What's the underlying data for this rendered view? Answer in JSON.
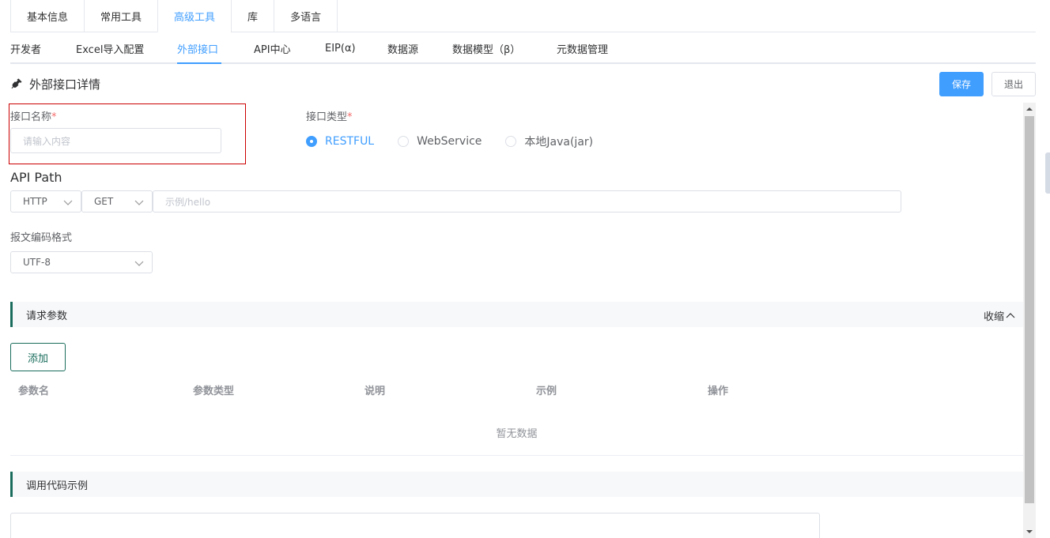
{
  "top_tabs": [
    {
      "label": "基本信息"
    },
    {
      "label": "常用工具"
    },
    {
      "label": "高级工具",
      "active": true
    },
    {
      "label": "库"
    },
    {
      "label": "多语言"
    }
  ],
  "sub_tabs": [
    {
      "label": "开发者"
    },
    {
      "label": "Excel导入配置"
    },
    {
      "label": "外部接口",
      "active": true
    },
    {
      "label": "API中心"
    },
    {
      "label": "EIP(α)"
    },
    {
      "label": "数据源"
    },
    {
      "label": "数据模型（β）"
    },
    {
      "label": "元数据管理"
    }
  ],
  "header": {
    "title": "外部接口详情",
    "icon": "plug-icon",
    "save_label": "保存",
    "exit_label": "退出"
  },
  "form": {
    "name_label": "接口名称",
    "required_mark": "*",
    "name_placeholder": "请输入内容",
    "type_label": "接口类型",
    "type_options": [
      {
        "label": "RESTFUL",
        "checked": true
      },
      {
        "label": "WebService",
        "checked": false
      },
      {
        "label": "本地Java(jar)",
        "checked": false
      }
    ],
    "api_path_label": "API Path",
    "protocol_value": "HTTP",
    "method_value": "GET",
    "path_placeholder": "示例/hello",
    "encoding_label": "报文编码格式",
    "encoding_value": "UTF-8"
  },
  "request_params": {
    "title": "请求参数",
    "collapse_label": "收缩",
    "add_label": "添加",
    "columns": [
      "参数名",
      "参数类型",
      "说明",
      "示例",
      "操作"
    ],
    "empty_text": "暂无数据"
  },
  "code_example": {
    "title": "调用代码示例"
  },
  "colors": {
    "primary": "#409eff",
    "accent_green": "#1a6d5c",
    "required": "#f56c6c"
  }
}
